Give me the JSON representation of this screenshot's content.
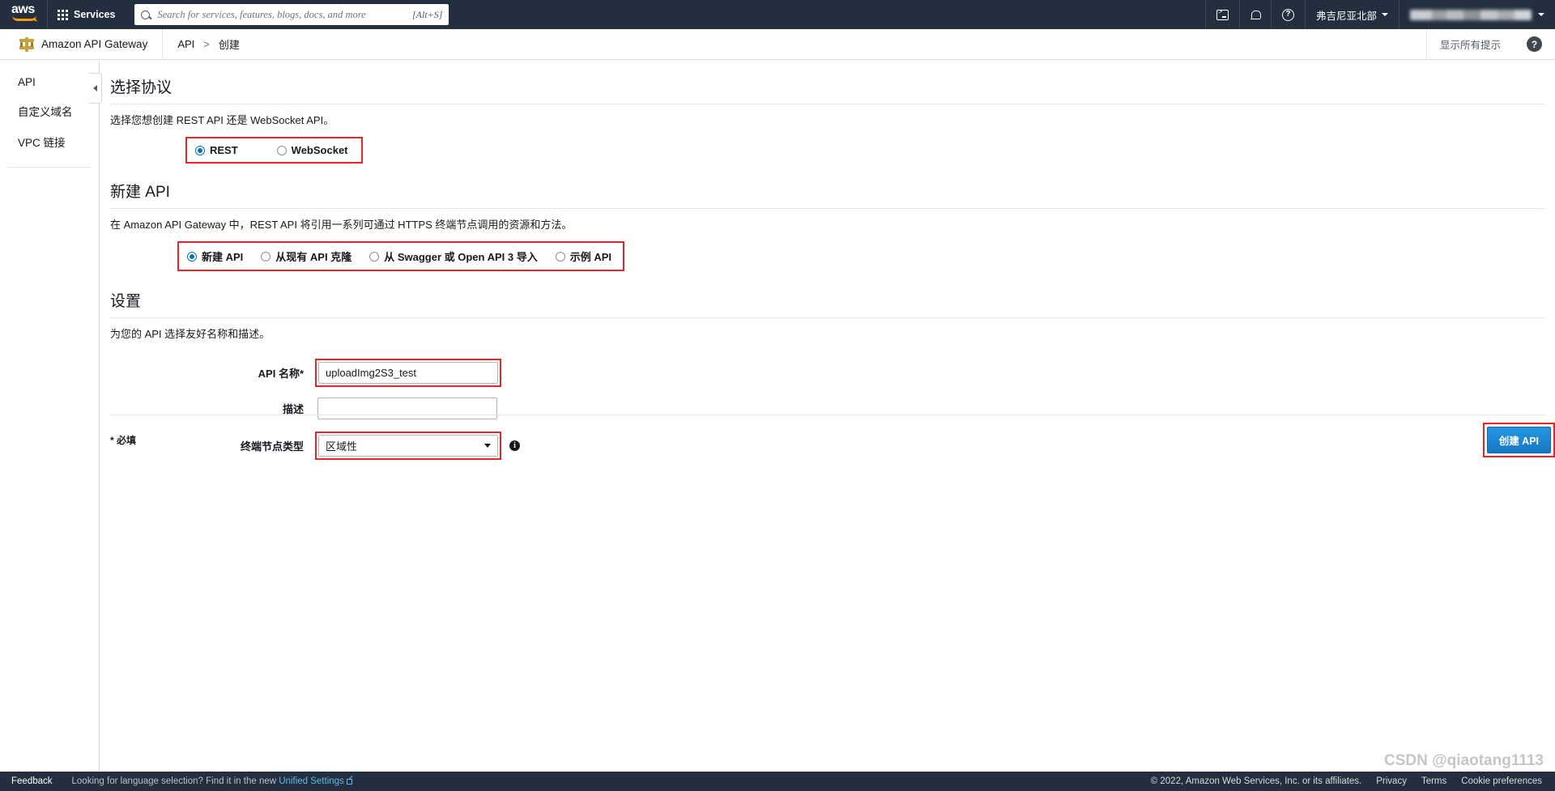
{
  "topnav": {
    "logo_text": "aws",
    "services_label": "Services",
    "search": {
      "placeholder": "Search for services, features, blogs, docs, and more",
      "value": "",
      "shortcut": "[Alt+S]"
    },
    "cloudshell_title": "CloudShell",
    "notifications_title": "Notifications",
    "help_title": "Help",
    "region": "弗吉尼亚北部",
    "account": ""
  },
  "service_bar": {
    "service_name": "Amazon API Gateway",
    "breadcrumb": [
      "API",
      "创建"
    ],
    "breadcrumb_sep": ">",
    "show_hints": "显示所有提示",
    "help_glyph": "?"
  },
  "sidebar": {
    "items": [
      {
        "label": "API"
      },
      {
        "label": "自定义域名"
      },
      {
        "label": "VPC 链接"
      }
    ]
  },
  "main": {
    "protocol": {
      "heading": "选择协议",
      "description": "选择您想创建 REST API 还是 WebSocket API。",
      "options": [
        {
          "label": "REST",
          "selected": true
        },
        {
          "label": "WebSocket",
          "selected": false
        }
      ]
    },
    "new_api": {
      "heading": "新建 API",
      "description": "在 Amazon API Gateway 中，REST API 将引用一系列可通过 HTTPS 终端节点调用的资源和方法。",
      "options": [
        {
          "label": "新建 API",
          "selected": true
        },
        {
          "label": "从现有 API 克隆",
          "selected": false
        },
        {
          "label": "从 Swagger 或 Open API 3 导入",
          "selected": false
        },
        {
          "label": "示例 API",
          "selected": false
        }
      ]
    },
    "settings": {
      "heading": "设置",
      "description": "为您的 API 选择友好名称和描述。",
      "fields": {
        "api_name": {
          "label": "API 名称*",
          "value": "uploadImg2S3_test",
          "placeholder": ""
        },
        "description": {
          "label": "描述",
          "value": "",
          "placeholder": ""
        },
        "endpoint_type": {
          "label": "终端节点类型",
          "value": "区域性",
          "info_glyph": "i"
        }
      }
    },
    "footer": {
      "required_note": "* 必填",
      "create_button": "创建 API"
    }
  },
  "bottom_bar": {
    "feedback": "Feedback",
    "language_note": "Looking for language selection? Find it in the new",
    "unified_settings": "Unified Settings",
    "copyright": "© 2022, Amazon Web Services, Inc. or its affiliates.",
    "privacy": "Privacy",
    "terms": "Terms",
    "cookie_preferences": "Cookie preferences"
  },
  "watermark": "CSDN @qiaotang1113",
  "colors": {
    "nav_bg": "#232f3e",
    "accent_blue": "#0073bb",
    "highlight_red": "#ee2222",
    "button_blue": "#1878c4"
  }
}
